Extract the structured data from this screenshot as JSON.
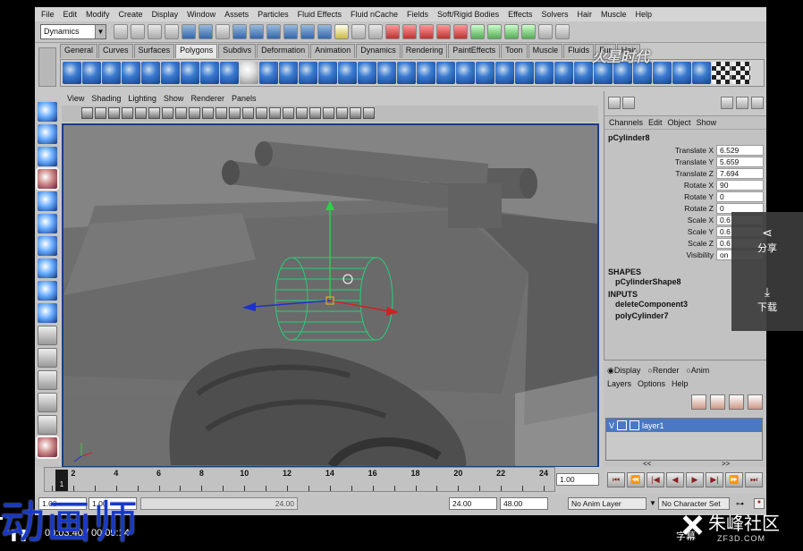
{
  "menubar": [
    "File",
    "Edit",
    "Modify",
    "Create",
    "Display",
    "Window",
    "Assets",
    "Particles",
    "Fluid Effects",
    "Fluid nCache",
    "Fields",
    "Soft/Rigid Bodies",
    "Effects",
    "Solvers",
    "Hair",
    "Muscle",
    "Help"
  ],
  "status": {
    "mode": "Dynamics"
  },
  "shelf": {
    "tabs": [
      "General",
      "Curves",
      "Surfaces",
      "Polygons",
      "Subdivs",
      "Deformation",
      "Animation",
      "Dynamics",
      "Rendering",
      "PaintEffects",
      "Toon",
      "Muscle",
      "Fluids",
      "Fur",
      "Hair"
    ],
    "active_tab": "Polygons"
  },
  "viewport": {
    "menu": [
      "View",
      "Shading",
      "Lighting",
      "Show",
      "Renderer",
      "Panels"
    ]
  },
  "channelbox": {
    "menu": [
      "Channels",
      "Edit",
      "Object",
      "Show"
    ],
    "object": "pCylinder8",
    "attrs": [
      {
        "name": "Translate X",
        "value": "6.529"
      },
      {
        "name": "Translate Y",
        "value": "5.659"
      },
      {
        "name": "Translate Z",
        "value": "7.694"
      },
      {
        "name": "Rotate X",
        "value": "90"
      },
      {
        "name": "Rotate Y",
        "value": "0"
      },
      {
        "name": "Rotate Z",
        "value": "0"
      },
      {
        "name": "Scale X",
        "value": "0.6"
      },
      {
        "name": "Scale Y",
        "value": "0.6"
      },
      {
        "name": "Scale Z",
        "value": "0.6"
      },
      {
        "name": "Visibility",
        "value": "on"
      }
    ],
    "shapes_label": "SHAPES",
    "shape": "pCylinderShape8",
    "inputs_label": "INPUTS",
    "inputs": [
      "deleteComponent3",
      "polyCylinder7"
    ]
  },
  "layers": {
    "modes": [
      "Display",
      "Render",
      "Anim"
    ],
    "active_mode": "Display",
    "menu": [
      "Layers",
      "Options",
      "Help"
    ],
    "layer_v": "V",
    "layer_name": "layer1",
    "nav_left": "<<",
    "nav_right": ">>"
  },
  "timeline": {
    "ticks": [
      "2",
      "4",
      "6",
      "8",
      "10",
      "12",
      "14",
      "16",
      "18",
      "20",
      "22",
      "24"
    ],
    "current": "1",
    "current_field": "1.00"
  },
  "range": {
    "start": "1.00",
    "playstart": "1.00",
    "bar_label": "24.00",
    "playend": "24.00",
    "end": "48.00",
    "anim_layer": "No Anim Layer",
    "char_set": "No Character Set"
  },
  "side_panel": {
    "share": "分享",
    "download": "下载"
  },
  "watermark": "火星时代",
  "subtitle": "动画师",
  "player": {
    "time": "00:03:40 / 00:09:14",
    "cc": "字幕"
  },
  "logo": {
    "name": "朱峰社区",
    "url": "ZF3D.COM"
  }
}
